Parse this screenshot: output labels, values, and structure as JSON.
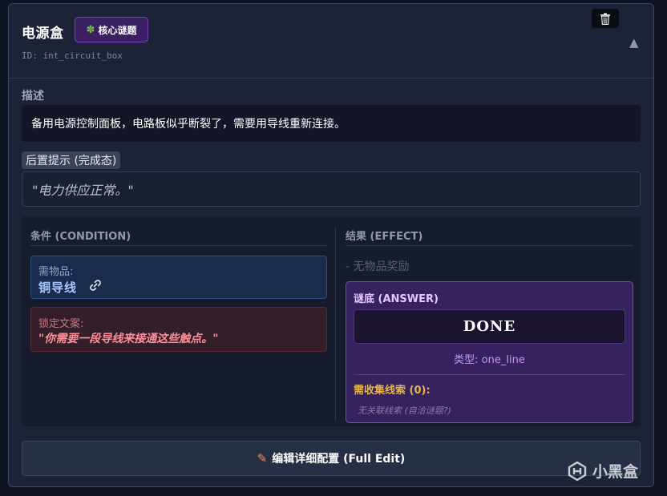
{
  "header": {
    "title": "电源盒",
    "badge": {
      "icon": "puzzle-icon",
      "label": "核心谜题"
    },
    "id_line": "ID: int_circuit_box"
  },
  "description": {
    "label": "描述",
    "text": "备用电源控制面板，电路板似乎断裂了，需要用导线重新连接。"
  },
  "post_hint": {
    "label": "后置提示 (完成态)",
    "text": "\"电力供应正常。\""
  },
  "condition": {
    "title": "条件 (CONDITION)",
    "needs_label": "需物品:",
    "needs_item": "铜导线",
    "locked_label": "锁定文案:",
    "locked_text": "\"你需要一段导线来接通这些触点。\""
  },
  "effect": {
    "title": "结果 (EFFECT)",
    "no_reward": "- 无物品奖励",
    "answer": {
      "label": "谜底 (ANSWER)",
      "value": "DONE",
      "type_prefix": "类型: ",
      "type_value": "one_line"
    },
    "clues": {
      "label": "需收集线索 (0):",
      "empty": "无关联线索 (自洽谜题?)"
    }
  },
  "edit_button": {
    "label": "编辑详细配置 (Full Edit)"
  },
  "watermark": "小黑盒",
  "colors": {
    "card_bg": "#1d2336",
    "badge_bg": "#3a1f63",
    "answer_bg": "#35225e",
    "needs_bg": "#1a2b4e",
    "locked_bg": "#331e2a",
    "locked_text": "#ff8f96",
    "clue_label": "#e5b54a"
  }
}
